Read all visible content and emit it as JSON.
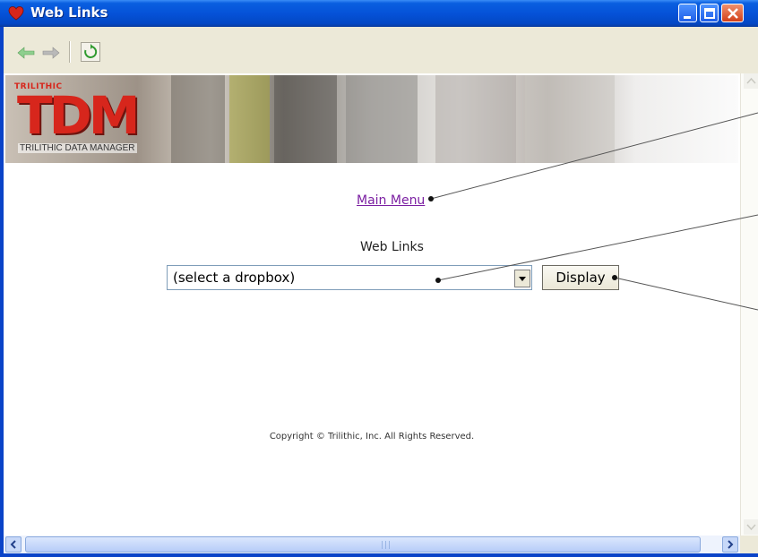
{
  "window": {
    "title": "Web Links",
    "buttons": [
      "minimize",
      "maximize",
      "close"
    ]
  },
  "toolbar": {
    "back_icon": "back-arrow-icon",
    "forward_icon": "forward-arrow-icon",
    "refresh_icon": "refresh-icon"
  },
  "banner": {
    "brand": "TRILITHIC",
    "logo": "TDM",
    "tagline": "TRILITHIC DATA MANAGER"
  },
  "main": {
    "main_menu_link": "Main Menu",
    "heading": "Web Links",
    "select": {
      "value": "(select a dropbox)"
    },
    "display_button": "Display",
    "copyright": "Copyright © Trilithic, Inc. All Rights Reserved."
  },
  "colors": {
    "title_bar": "#0552d8",
    "link": "#7b1fa2",
    "logo_red": "#d7261c",
    "chrome": "#ece9d8"
  }
}
